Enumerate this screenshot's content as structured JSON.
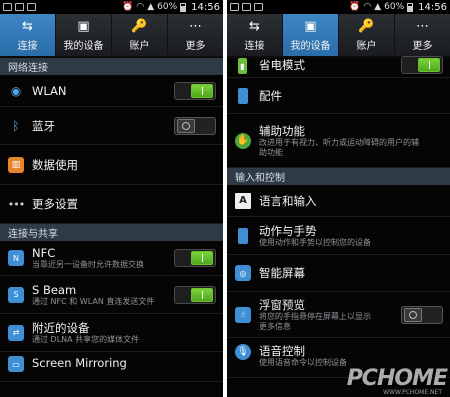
{
  "left": {
    "status": {
      "battery_pct": "60%",
      "time": "14:56"
    },
    "tabs": [
      {
        "label": "连接",
        "icon": "connections-icon"
      },
      {
        "label": "我的设备",
        "icon": "my-device-icon"
      },
      {
        "label": "账户",
        "icon": "accounts-icon"
      },
      {
        "label": "更多",
        "icon": "more-icon"
      }
    ],
    "active_tab": "连接",
    "sections": {
      "network": "网络连接",
      "share": "连接与共享"
    },
    "items": {
      "wlan": {
        "title": "WLAN",
        "toggle": "on"
      },
      "bluetooth": {
        "title": "蓝牙",
        "toggle": "off"
      },
      "data_usage": {
        "title": "数据使用"
      },
      "more_settings": {
        "title": "更多设置"
      },
      "nfc": {
        "title": "NFC",
        "subtitle": "当靠近另一设备时允许数据交换",
        "toggle": "on"
      },
      "sbeam": {
        "title": "S Beam",
        "subtitle": "通过 NFC 和 WLAN 直连发送文件",
        "toggle": "on"
      },
      "nearby": {
        "title": "附近的设备",
        "subtitle": "通过 DLNA 共享您的媒体文件"
      },
      "screen_mirroring": {
        "title": "Screen Mirroring"
      }
    }
  },
  "right": {
    "status": {
      "battery_pct": "60%",
      "time": "14:56"
    },
    "tabs": [
      {
        "label": "连接",
        "icon": "connections-icon"
      },
      {
        "label": "我的设备",
        "icon": "my-device-icon"
      },
      {
        "label": "账户",
        "icon": "accounts-icon"
      },
      {
        "label": "更多",
        "icon": "more-icon"
      }
    ],
    "active_tab": "我的设备",
    "sections": {
      "input": "输入和控制"
    },
    "items": {
      "power_saving": {
        "title": "省电模式",
        "toggle": "on"
      },
      "accessories": {
        "title": "配件"
      },
      "accessibility": {
        "title": "辅助功能",
        "subtitle1": "改进用于有视力、听力或运动障碍的用户的辅",
        "subtitle2": "助功能"
      },
      "language_input": {
        "title": "语言和输入"
      },
      "motions": {
        "title": "动作与手势",
        "subtitle": "使用动作和手势以控制您的设备"
      },
      "smart_screen": {
        "title": "智能屏幕"
      },
      "air_view": {
        "title": "浮窗预览",
        "subtitle1": "将您的手指悬停在屏幕上以显示",
        "subtitle2": "更多信息",
        "toggle": "off"
      },
      "voice_control": {
        "title": "语音控制",
        "subtitle": "使用语音命令以控制设备"
      }
    },
    "watermark": "PCHOME",
    "watermark_sub": "WWW.PCHOME.NET"
  },
  "colors": {
    "accent_tab": "#2a6ea9",
    "toggle_on": "#6fc22f",
    "background": "#050505"
  }
}
